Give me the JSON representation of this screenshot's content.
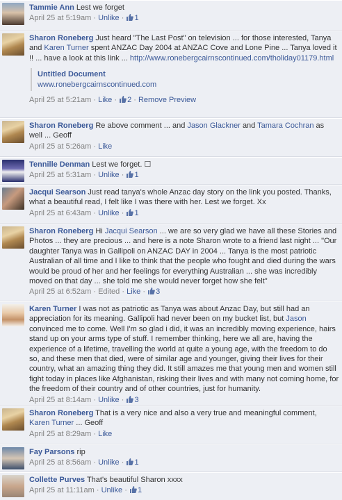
{
  "comments": [
    {
      "name": "Tammie Ann",
      "text": "Lest we forget",
      "time": "April 25 at 5:19am",
      "action": "Unlike",
      "likes": "1",
      "avatar": "tammie"
    },
    {
      "name": "Sharon Roneberg",
      "text_a": "Just heard \"The Last Post\" on television ... for those interested, Tanya and",
      "mention": "Karen Turner",
      "text_b": "spent ANZAC Day 2004 at ANZAC Cove and Lone Pine ... Tanya loved it !! ... have a look at this link ...",
      "url": "http://www.ronebergcairnscontinued.com/tholiday01179.html",
      "attachment_title": "Untitled Document",
      "attachment_url": "www.ronebergcairnscontinued.com",
      "time": "April 25 at 5:21am",
      "action": "Like",
      "likes": "2",
      "extra_action": "Remove Preview",
      "avatar": "sharon"
    },
    {
      "name": "Sharon Roneberg",
      "text_a": "Re above comment ... and",
      "mention1": "Jason Glackner",
      "and": "and",
      "mention2": "Tamara Cochran",
      "text_b": "as well ... Geoff",
      "time": "April 25 at 5:26am",
      "action": "Like",
      "avatar": "sharon"
    },
    {
      "name": "Tennille Denman",
      "text": "Lest we forget. ☐",
      "time": "April 25 at 5:31am",
      "action": "Unlike",
      "likes": "1",
      "avatar": "tennille"
    },
    {
      "name": "Jacqui Searson",
      "text": "Just read tanya's whole Anzac day story on the link you posted. Thanks, what a beautiful read, I felt like I was there with her. Lest we forget. Xx",
      "time": "April 25 at 6:43am",
      "action": "Unlike",
      "likes": "1",
      "avatar": "jacqui"
    },
    {
      "name": "Sharon Roneberg",
      "text_a": "Hi",
      "mention": "Jacqui Searson",
      "text_b": "... we are so very glad we have all these Stories and Photos ... they are precious ... and here is a note Sharon wrote to a friend last night ... \"Our daughter Tanya was in Gallipoli on ANZAC DAY in 2004 ... Tanya is the most patriotic Australian of all time and I like to think that the people who fought and died during the wars would be proud of her and her feelings for everything Australian ... she was incredibly moved on that day ... she told me she would never forget how she felt\"",
      "time": "April 25 at 6:52am",
      "edited": "Edited",
      "action": "Like",
      "likes": "3",
      "avatar": "sharon"
    },
    {
      "name": "Karen Turner",
      "text_a": "I was not as patriotic as Tanya was about Anzac Day, but still had an appreciation for its meaning. Gallipoli had never been on my bucket list, but",
      "mention": "Jason",
      "text_b": "convinced me to come. Well I'm so glad i did, it was an incredibly moving experience, hairs stand up on your arms type of stuff. I remember thinking, here we all are, having the experience of a lifetime, travelling the world at quite a young age, with the freedom to do so, and these men that died, were of similar age and younger, giving their lives for their country, what an amazing thing they did. It still amazes me that young men and women still fight today in places like Afghanistan, risking their lives and with many not coming home, for the freedom of their country and of other countries, just for humanity.",
      "time": "April 25 at 8:14am",
      "action": "Unlike",
      "likes": "3",
      "avatar": "karen"
    },
    {
      "name": "Sharon Roneberg",
      "text_a": "That is a very nice and also a very true and meaningful comment,",
      "mention": "Karen Turner",
      "text_b": "... Geoff",
      "time": "April 25 at 8:29am",
      "action": "Like",
      "avatar": "sharon"
    },
    {
      "name": "Fay Parsons",
      "text": "rip",
      "time": "April 25 at 8:56am",
      "action": "Unlike",
      "likes": "1",
      "avatar": "fay"
    },
    {
      "name": "Collette Purves",
      "text": "That's beautiful Sharon xxxx",
      "time": "April 25 at 11:11am",
      "action": "Unlike",
      "likes": "1",
      "avatar": "collette"
    }
  ],
  "separator": "·",
  "colors": {
    "link": "#3b5998",
    "meta": "#808080",
    "background": "#edeff4"
  }
}
